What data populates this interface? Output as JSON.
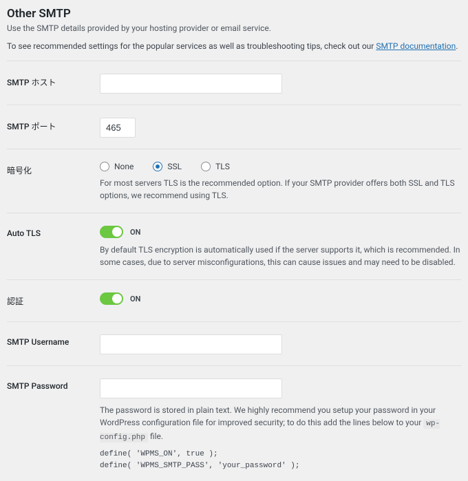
{
  "header": {
    "title": "Other SMTP",
    "subtitle": "Use the SMTP details provided by your hosting provider or email service.",
    "intro_prefix": "To see recommended settings for the popular services as well as troubleshooting tips, check out our ",
    "link_text": "SMTP documentation",
    "intro_suffix": "."
  },
  "rows": {
    "host": {
      "label": "SMTP ホスト",
      "value": ""
    },
    "port": {
      "label": "SMTP ポート",
      "value": "465"
    },
    "encryption": {
      "label": "暗号化",
      "options": {
        "none": "None",
        "ssl": "SSL",
        "tls": "TLS"
      },
      "help": "For most servers TLS is the recommended option. If your SMTP provider offers both SSL and TLS options, we recommend using TLS."
    },
    "auto_tls": {
      "label": "Auto TLS",
      "state": "ON",
      "help": "By default TLS encryption is automatically used if the server supports it, which is recommended. In some cases, due to server misconfigurations, this can cause issues and may need to be disabled."
    },
    "auth": {
      "label": "認証",
      "state": "ON"
    },
    "username": {
      "label": "SMTP Username",
      "value": ""
    },
    "password": {
      "label": "SMTP Password",
      "value": "",
      "help_prefix": "The password is stored in plain text. We highly recommend you setup your password in your WordPress configuration file for improved security; to do this add the lines below to your ",
      "help_code": "wp-config.php",
      "help_suffix": " file.",
      "code1": "define( 'WPMS_ON', true );",
      "code2": "define( 'WPMS_SMTP_PASS', 'your_password' );"
    }
  }
}
